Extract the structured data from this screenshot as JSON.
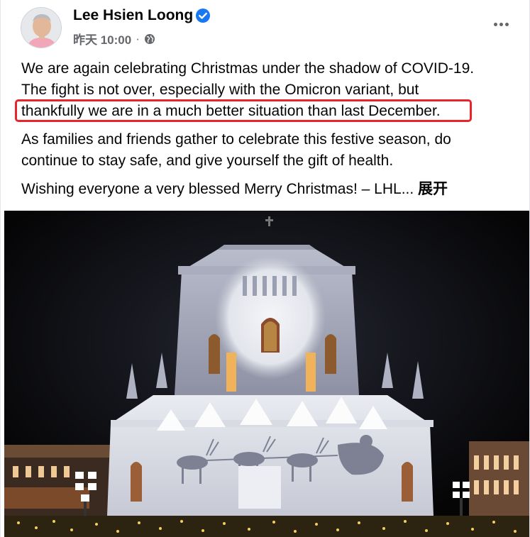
{
  "post": {
    "author": "Lee Hsien Loong",
    "timestamp": "昨天 10:00",
    "separator": "·",
    "paragraphs": {
      "p1_l1": "We are again celebrating Christmas under the shadow of COVID-19.",
      "p1_l2": "The fight is not over, especially with the Omicron variant, but",
      "p1_l3": "thankfully we are in a much better situation than last December.",
      "p2_l1": "As families and friends gather to celebrate this festive season, do",
      "p2_l2": "continue to stay safe, and give yourself the gift of health.",
      "p3_l1": "Wishing everyone a very blessed Merry Christmas! – LHL..."
    },
    "see_more": "展开",
    "icons": {
      "verified": "verified-badge-icon",
      "audience": "globe-icon",
      "more": "more-options-icon"
    },
    "colors": {
      "verified_blue": "#1877f2",
      "highlight_red": "#e8252b",
      "meta_gray": "#65676b"
    }
  }
}
